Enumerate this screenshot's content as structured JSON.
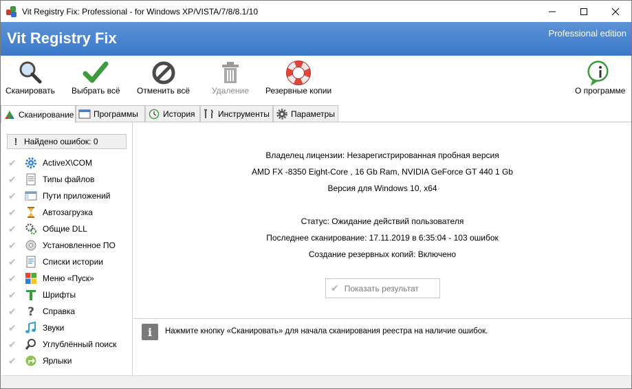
{
  "window": {
    "title": "Vit Registry Fix: Professional - for Windows XP/VISTA/7/8/8.1/10"
  },
  "banner": {
    "title": "Vit Registry Fix",
    "edition": "Professional edition"
  },
  "toolbar": {
    "scan": "Сканировать",
    "select_all": "Выбрать всё",
    "cancel_all": "Отменить всё",
    "delete": "Удаление",
    "backups": "Резервные копии",
    "about": "О программе"
  },
  "tabs": {
    "scan": "Сканирование",
    "programs": "Программы",
    "history": "История",
    "tools": "Инструменты",
    "settings": "Параметры"
  },
  "sidebar": {
    "errors_found": "Найдено ошибок: 0",
    "items": [
      {
        "label": "ActiveX\\COM",
        "icon": "gear-icon"
      },
      {
        "label": "Типы файлов",
        "icon": "document-icon"
      },
      {
        "label": "Пути приложений",
        "icon": "window-icon"
      },
      {
        "label": "Автозагрузка",
        "icon": "hourglass-icon"
      },
      {
        "label": "Общие DLL",
        "icon": "gears-icon"
      },
      {
        "label": "Установленное ПО",
        "icon": "disc-icon"
      },
      {
        "label": "Списки истории",
        "icon": "list-document-icon"
      },
      {
        "label": "Меню «Пуск»",
        "icon": "windows-logo-icon"
      },
      {
        "label": "Шрифты",
        "icon": "font-icon"
      },
      {
        "label": "Справка",
        "icon": "question-icon"
      },
      {
        "label": "Звуки",
        "icon": "music-note-icon"
      },
      {
        "label": "Углублённый поиск",
        "icon": "magnifier-icon"
      },
      {
        "label": "Ярлыки",
        "icon": "shortcut-icon"
      }
    ]
  },
  "main": {
    "license": "Владелец лицензии: Незарегистрированная пробная версия",
    "hardware": "AMD FX -8350 Eight-Core , 16 Gb Ram, NVIDIA GeForce GT 440 1 Gb",
    "os_version": "Версия для Windows 10, x64",
    "status": "Статус: Ожидание действий пользователя",
    "last_scan": "Последнее сканирование: 17.11.2019 в 6:35:04 - 103 ошибок",
    "backup": "Создание резервных копий: Включено",
    "show_results": "Показать результат"
  },
  "hint": {
    "text": "Нажмите кнопку «Сканировать» для начала сканирования реестра на наличие ошибок."
  },
  "colors": {
    "banner": "#3a78c9",
    "check_green": "#3c9b3c",
    "lifebuoy_red": "#e0443a"
  }
}
